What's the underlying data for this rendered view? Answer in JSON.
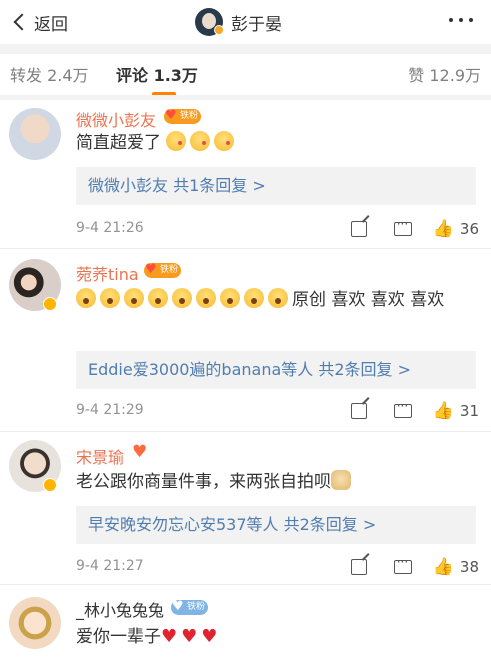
{
  "header": {
    "back_label": "返回",
    "title": "彭于晏"
  },
  "tabs": {
    "repost": "转发 2.4万",
    "comment": "评论 1.3万",
    "like": "赞 12.9万"
  },
  "colors": {
    "accent": "#ff8200",
    "username": "#eb7350",
    "link": "#507daf"
  },
  "comments": [
    {
      "username": "微微小彭友",
      "badge": "铁粉",
      "text": "简直超爱了",
      "emoji": [
        "kiss-emoji",
        "kiss-emoji",
        "kiss-emoji"
      ],
      "reply_summary": "微微小彭友  共1条回复 >",
      "time": "9-4 21:26",
      "likes": "36"
    },
    {
      "username": "菀荞tina",
      "badge": "铁粉",
      "text_prefix_emoji": [
        "wow-emoji",
        "wow-emoji",
        "wow-emoji",
        "wow-emoji",
        "wow-emoji",
        "wow-emoji",
        "wow-emoji",
        "wow-emoji",
        "wow-emoji"
      ],
      "text": "原创 喜欢 喜欢 喜欢",
      "reply_summary": "Eddie爱3000遍的banana等人  共2条回复 >",
      "time": "9-4 21:29",
      "likes": "31"
    },
    {
      "username": "宋景瑜",
      "text": "老公跟你商量件事，来两张自拍呗",
      "emoji": [
        "doge-emoji"
      ],
      "reply_summary": "早安晚安勿忘心安537等人  共2条回复 >",
      "time": "9-4 21:27",
      "likes": "38"
    },
    {
      "username": "_林小兔兔兔",
      "badge": "铁粉",
      "text": "爱你一辈子",
      "emoji": [
        "heart-emoji",
        "heart-emoji",
        "heart-emoji"
      ]
    }
  ]
}
